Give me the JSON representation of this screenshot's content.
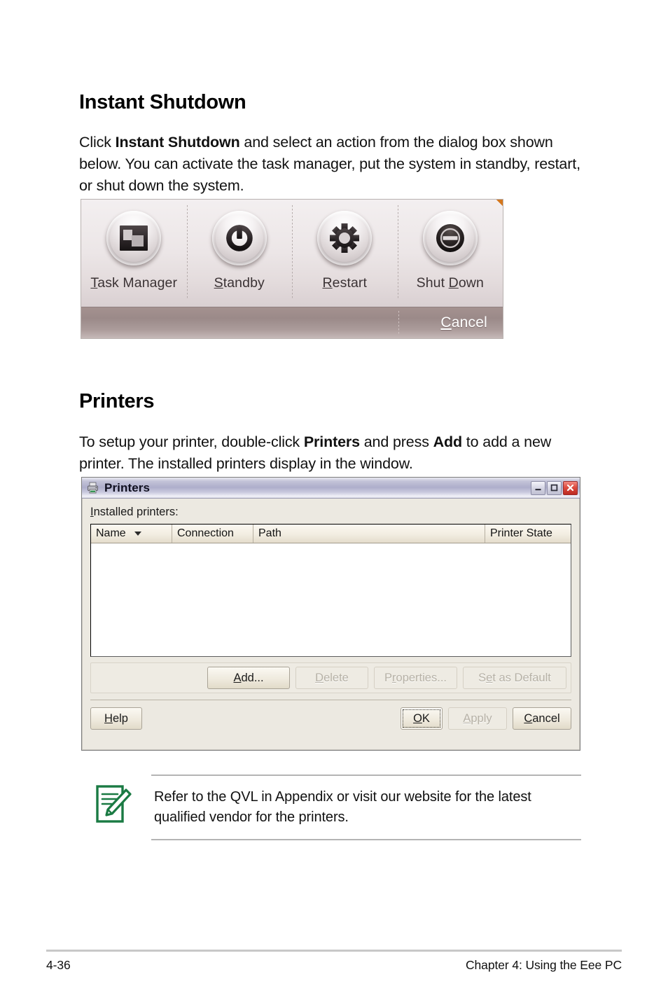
{
  "sections": {
    "instant_shutdown": {
      "heading": "Instant Shutdown",
      "paragraph_html": "Click <b>Instant Shutdown</b> and select an action from the dialog box shown below. You can activate the task manager, put the system in standby, restart, or shut down the system."
    },
    "printers": {
      "heading": "Printers",
      "paragraph_html": "To setup your printer, double-click <b>Printers</b> and press <b>Add</b> to add a new printer. The installed printers display in the window."
    }
  },
  "shutdown_dialog": {
    "actions": [
      {
        "label_html": "<u>T</u>ask Manager",
        "icon": "task-manager-icon"
      },
      {
        "label_html": "<u>S</u>tandby",
        "icon": "power-standby-icon"
      },
      {
        "label_html": "<u>R</u>estart",
        "icon": "gear-restart-icon"
      },
      {
        "label_html": "Shut <u>D</u>own",
        "icon": "shut-down-icon"
      }
    ],
    "cancel_label_html": "<u>C</u>ancel"
  },
  "printers_window": {
    "title": "Printers",
    "title_icon": "printer-icon",
    "window_controls": [
      {
        "name": "minimize-button",
        "glyph": "minimize-icon"
      },
      {
        "name": "maximize-button",
        "glyph": "maximize-icon"
      },
      {
        "name": "close-button",
        "glyph": "close-icon"
      }
    ],
    "installed_printers_label_html": "<u>I</u>nstalled printers:",
    "columns": [
      "Name",
      "Connection",
      "Path",
      "Printer State"
    ],
    "rows": [],
    "action_buttons": [
      {
        "label_html": "<u>A</u>dd...",
        "enabled": true
      },
      {
        "label_html": "<u>D</u>elete",
        "enabled": false
      },
      {
        "label_html": "P<u>r</u>operties...",
        "enabled": false
      },
      {
        "label_html": "S<u>e</u>t as Default",
        "enabled": false
      }
    ],
    "footer_buttons": {
      "help": {
        "label_html": "<u>H</u>elp",
        "enabled": true
      },
      "ok": {
        "label_html": "<u>O</u>K",
        "enabled": true,
        "focused": true
      },
      "apply": {
        "label_html": "<u>A</u>pply",
        "enabled": false
      },
      "cancel": {
        "label_html": "<u>C</u>ancel",
        "enabled": true
      }
    }
  },
  "note": {
    "icon": "note-pencil-icon",
    "text": "Refer to the QVL in Appendix or visit our website for the latest qualified vendor for the printers.",
    "accent_color": "#1a7a43"
  },
  "page_footer": {
    "page_number": "4-36",
    "chapter": "Chapter 4: Using the Eee PC"
  }
}
